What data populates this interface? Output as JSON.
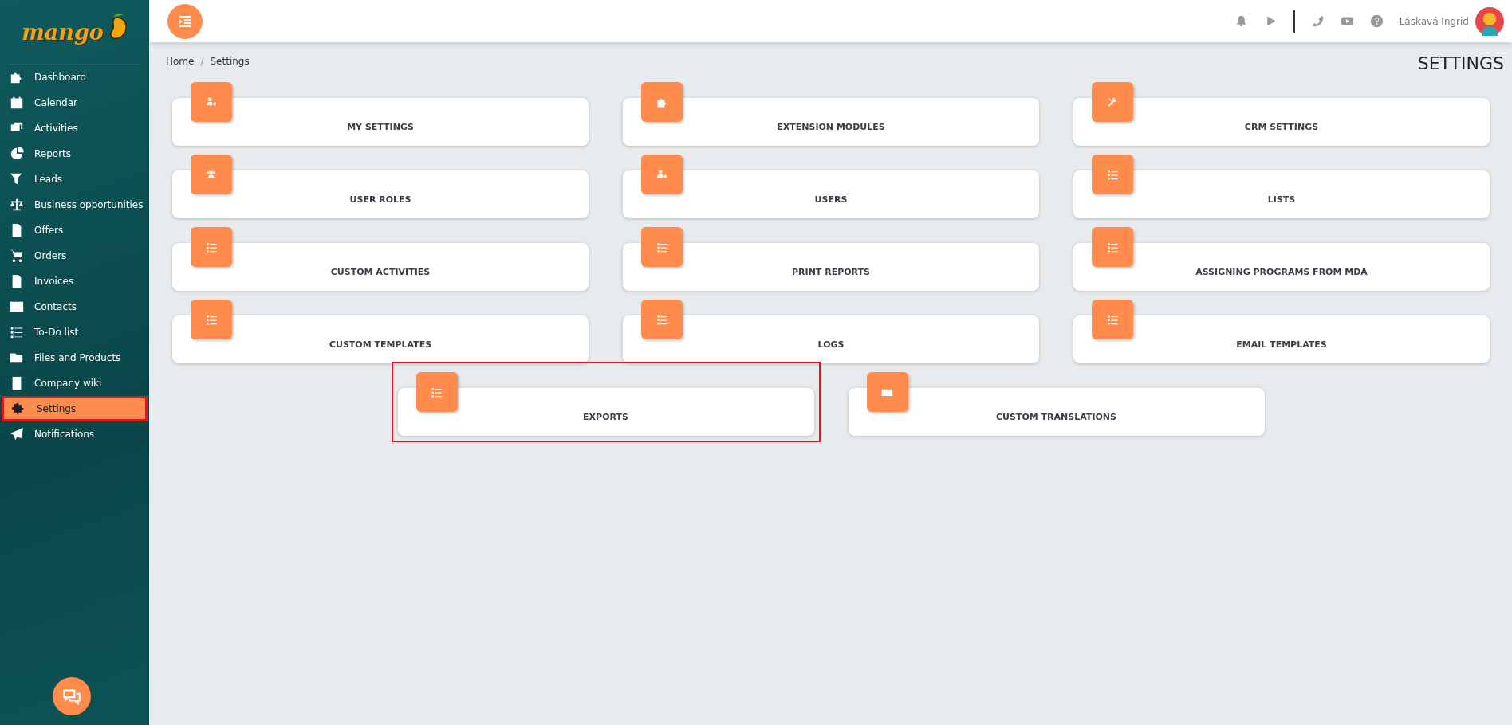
{
  "sidebar": {
    "logo": "mango",
    "items": [
      {
        "label": "Dashboard",
        "selected": false,
        "highlighted": false
      },
      {
        "label": "Calendar",
        "selected": false,
        "highlighted": false
      },
      {
        "label": "Activities",
        "selected": false,
        "highlighted": false
      },
      {
        "label": "Reports",
        "selected": false,
        "highlighted": false
      },
      {
        "label": "Leads",
        "selected": false,
        "highlighted": false
      },
      {
        "label": "Business opportunities",
        "selected": false,
        "highlighted": false
      },
      {
        "label": "Offers",
        "selected": false,
        "highlighted": false
      },
      {
        "label": "Orders",
        "selected": false,
        "highlighted": false
      },
      {
        "label": "Invoices",
        "selected": false,
        "highlighted": false
      },
      {
        "label": "Contacts",
        "selected": false,
        "highlighted": false
      },
      {
        "label": "To-Do list",
        "selected": false,
        "highlighted": false
      },
      {
        "label": "Files and Products",
        "selected": false,
        "highlighted": false
      },
      {
        "label": "Company wiki",
        "selected": false,
        "highlighted": false
      },
      {
        "label": "Settings",
        "selected": true,
        "highlighted": true
      },
      {
        "label": "Notifications",
        "selected": false,
        "highlighted": false
      }
    ]
  },
  "header": {
    "user_name": "Láskavá Ingrid"
  },
  "breadcrumb": {
    "items": [
      "Home",
      "Settings"
    ],
    "separator": "/"
  },
  "page_title": "SETTINGS",
  "tiles": [
    {
      "label": "MY SETTINGS",
      "highlighted": false
    },
    {
      "label": "EXTENSION MODULES",
      "highlighted": false
    },
    {
      "label": "CRM SETTINGS",
      "highlighted": false
    },
    {
      "label": "USER ROLES",
      "highlighted": false
    },
    {
      "label": "USERS",
      "highlighted": false
    },
    {
      "label": "LISTS",
      "highlighted": false
    },
    {
      "label": "CUSTOM ACTIVITIES",
      "highlighted": false
    },
    {
      "label": "PRINT REPORTS",
      "highlighted": false
    },
    {
      "label": "ASSIGNING PROGRAMS FROM MDA",
      "highlighted": false
    },
    {
      "label": "CUSTOM TEMPLATES",
      "highlighted": false
    },
    {
      "label": "LOGS",
      "highlighted": false
    },
    {
      "label": "EMAIL TEMPLATES",
      "highlighted": false
    },
    {
      "label": "EXPORTS",
      "highlighted": true
    },
    {
      "label": "CUSTOM TRANSLATIONS",
      "highlighted": false
    }
  ]
}
